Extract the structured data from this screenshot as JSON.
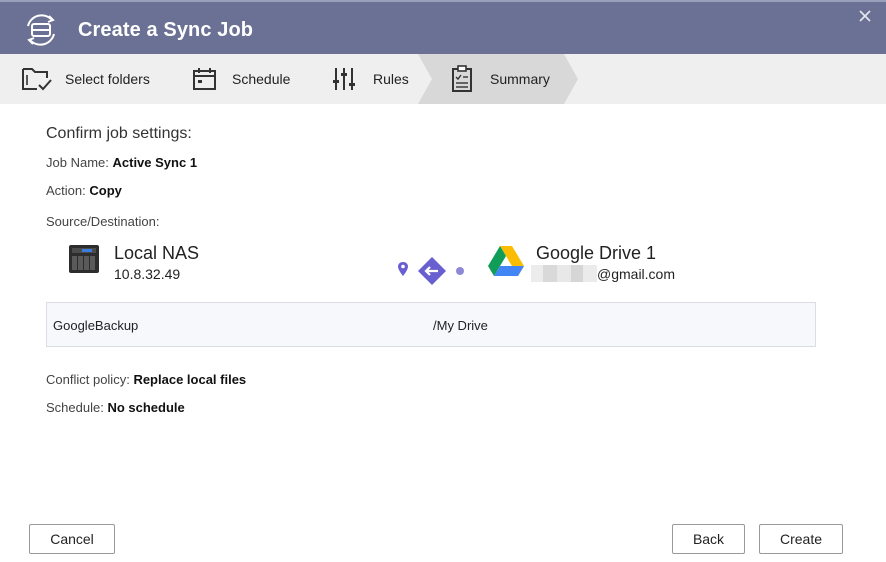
{
  "window": {
    "title": "Create a Sync Job",
    "colors": {
      "titlebar": "#6b7194",
      "accent": "#6a5fd1",
      "active_step": "#d8d8d8"
    }
  },
  "steps": [
    {
      "label": "Select folders",
      "icon": "folder-check-icon"
    },
    {
      "label": "Schedule",
      "icon": "calendar-icon"
    },
    {
      "label": "Rules",
      "icon": "sliders-icon"
    },
    {
      "label": "Summary",
      "icon": "clipboard-check-icon",
      "active": true
    }
  ],
  "summary": {
    "heading": "Confirm job settings:",
    "job_name_label": "Job Name:",
    "job_name": "Active Sync 1",
    "action_label": "Action:",
    "action": "Copy",
    "source_dest_label": "Source/Destination:",
    "source": {
      "name": "Local NAS",
      "address": "10.8.32.49",
      "icon": "nas-device-icon"
    },
    "destination": {
      "name": "Google Drive 1",
      "account_suffix": "@gmail.com",
      "icon": "google-drive-icon"
    },
    "direction_icon": "arrow-left-icon",
    "source_folder": "GoogleBackup",
    "destination_folder": "/My Drive",
    "conflict_label": "Conflict policy:",
    "conflict_policy": "Replace local files",
    "schedule_label": "Schedule:",
    "schedule": "No schedule"
  },
  "buttons": {
    "cancel": "Cancel",
    "back": "Back",
    "create": "Create"
  }
}
